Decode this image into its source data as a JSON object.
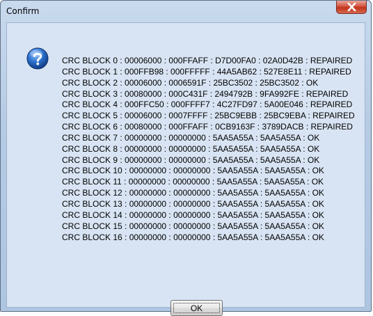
{
  "window": {
    "title": "Confirm",
    "close_icon": "close-x-icon"
  },
  "dialog": {
    "icon": "question-icon",
    "lines": [
      "CRC BLOCK 0 : 00006000 : 000FFAFF : D7D00FA0 : 02A0D42B : REPAIRED",
      "CRC BLOCK 1 : 000FFB98 : 000FFFFF : 44A5AB62 : 527E8E11 : REPAIRED",
      "CRC BLOCK 2 : 00006000 : 0006591F : 25BC3502 : 25BC3502 : OK",
      "CRC BLOCK 3 : 00080000 : 000C431F : 2494792B : 9FA992FE : REPAIRED",
      "CRC BLOCK 4 : 000FFC50 : 000FFFF7 : 4C27FD97 : 5A00E046 : REPAIRED",
      "CRC BLOCK 5 : 00006000 : 0007FFFF : 25BC9EBB : 25BC9EBA : REPAIRED",
      "CRC BLOCK 6 : 00080000 : 000FFAFF : 0CB9163F : 3789DACB : REPAIRED",
      "CRC BLOCK 7 : 00000000 : 00000000 : 5AA5A55A : 5AA5A55A : OK",
      "CRC BLOCK 8 : 00000000 : 00000000 : 5AA5A55A : 5AA5A55A : OK",
      "CRC BLOCK 9 : 00000000 : 00000000 : 5AA5A55A : 5AA5A55A : OK",
      "CRC BLOCK 10 : 00000000 : 00000000 : 5AA5A55A : 5AA5A55A : OK",
      "CRC BLOCK 11 : 00000000 : 00000000 : 5AA5A55A : 5AA5A55A : OK",
      "CRC BLOCK 12 : 00000000 : 00000000 : 5AA5A55A : 5AA5A55A : OK",
      "CRC BLOCK 13 : 00000000 : 00000000 : 5AA5A55A : 5AA5A55A : OK",
      "CRC BLOCK 14 : 00000000 : 00000000 : 5AA5A55A : 5AA5A55A : OK",
      "CRC BLOCK 15 : 00000000 : 00000000 : 5AA5A55A : 5AA5A55A : OK",
      "CRC BLOCK 16 : 00000000 : 00000000 : 5AA5A55A : 5AA5A55A : OK"
    ]
  },
  "buttons": {
    "ok_label": "OK"
  },
  "colors": {
    "client_background": "#d8e4f3",
    "frame": "#b6cbe4",
    "close_button": "#c2331b",
    "question_icon": "#2a6fc9"
  }
}
